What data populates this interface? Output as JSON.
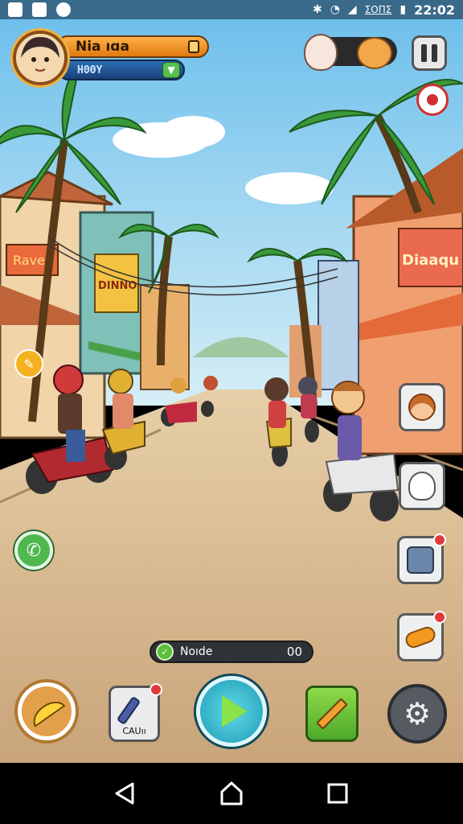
{
  "status_bar": {
    "time": "22:02",
    "carrier_text": "ΣOΠΣ",
    "icons": [
      "image-icon",
      "app-icon",
      "shield-icon",
      "bluetooth-icon",
      "wifi-icon",
      "signal-icon",
      "battery-icon"
    ]
  },
  "hud": {
    "player_name": "Nia ıɑa",
    "player_sub": "ΗΘΘΥ",
    "top_right_icons": [
      "npc-face-icon",
      "monkey-face-icon"
    ],
    "pause_icon": "pause-icon",
    "target_icon": "target-icon"
  },
  "scene": {
    "shop_sign_left": "Rave",
    "shop_sign_mid": "DINNO",
    "shop_sign_right": "Diaaqu",
    "icon": "street-scene"
  },
  "side_buttons": {
    "left_bubble_icon": "speech-bubble-icon",
    "phone_icon": "phone-icon",
    "cards": [
      {
        "icon": "kid-face-icon",
        "badge": false
      },
      {
        "icon": "ghost-icon",
        "badge": false
      },
      {
        "icon": "robot-box-icon",
        "badge": true
      },
      {
        "icon": "slipper-icon",
        "badge": true
      }
    ]
  },
  "mode_pill": {
    "label": "Noıde",
    "value": "00",
    "icon": "leaf-icon"
  },
  "bottom_bar": {
    "banana_icon": "banana-icon",
    "tool_label": "CAUıı",
    "tool_icon": "brush-icon",
    "play_icon": "play-icon",
    "pencil_icon": "pencil-icon",
    "gear_icon": "gear-icon"
  },
  "colors": {
    "sky": "#8fd0f0",
    "road": "#d8b890",
    "accent_orange": "#f59a20",
    "accent_blue": "#1f5a9a",
    "play_cyan": "#3fbfd8"
  }
}
